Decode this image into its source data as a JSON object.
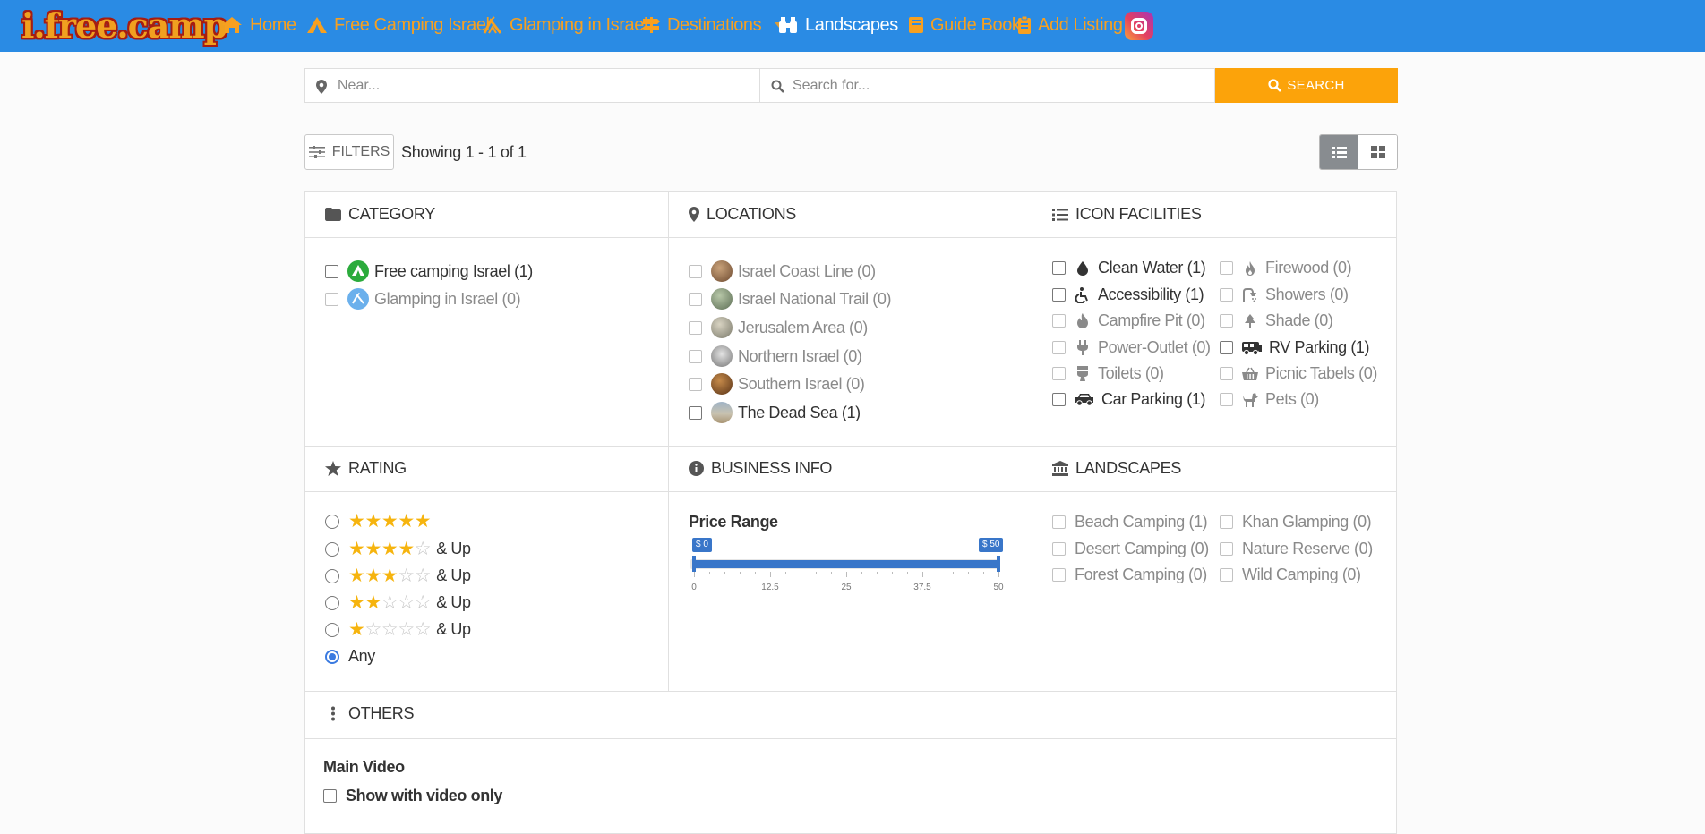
{
  "brand": {
    "logo_text": "i.free.camp"
  },
  "nav": {
    "items": [
      {
        "label": "Home",
        "icon": "home-icon"
      },
      {
        "label": "Free Camping Israel",
        "icon": "camping-tent-icon"
      },
      {
        "label": "Glamping in Israel",
        "icon": "glamping-tent-icon"
      },
      {
        "label": "Destinations",
        "icon": "signpost-icon",
        "dropdown": true
      },
      {
        "label": "Landscapes",
        "icon": "binoculars-icon",
        "dropdown": true,
        "active": true
      },
      {
        "label": "Guide Book",
        "icon": "book-icon"
      },
      {
        "label": "Add Listing",
        "icon": "clipboard-icon"
      }
    ],
    "social_icon": "instagram-icon"
  },
  "search": {
    "near_placeholder": "Near...",
    "query_placeholder": "Search for...",
    "button_label": "SEARCH"
  },
  "toolbar": {
    "filters_label": "FILTERS",
    "showing_text": "Showing 1 - 1 of 1",
    "view_modes": [
      "list",
      "grid"
    ],
    "active_view": "list"
  },
  "filters": {
    "category": {
      "title": "CATEGORY",
      "options": [
        {
          "label": "Free camping Israel (1)",
          "enabled": true
        },
        {
          "label": "Glamping in Israel (0)",
          "enabled": false
        }
      ]
    },
    "locations": {
      "title": "LOCATIONS",
      "options": [
        {
          "label": "Israel Coast Line (0)",
          "enabled": false
        },
        {
          "label": "Israel National Trail (0)",
          "enabled": false
        },
        {
          "label": "Jerusalem Area (0)",
          "enabled": false
        },
        {
          "label": "Northern Israel (0)",
          "enabled": false
        },
        {
          "label": "Southern Israel (0)",
          "enabled": false
        },
        {
          "label": "The Dead Sea (1)",
          "enabled": true
        }
      ]
    },
    "facilities": {
      "title": "ICON FACILITIES",
      "options": [
        {
          "label": "Clean Water (1)",
          "icon": "water-drop-icon",
          "enabled": true
        },
        {
          "label": "Firewood (0)",
          "icon": "fire-icon",
          "enabled": false
        },
        {
          "label": "Accessibility (1)",
          "icon": "wheelchair-icon",
          "enabled": true
        },
        {
          "label": "Showers (0)",
          "icon": "shower-icon",
          "enabled": false
        },
        {
          "label": "Campfire Pit (0)",
          "icon": "flame-icon",
          "enabled": false
        },
        {
          "label": "Shade (0)",
          "icon": "tree-icon",
          "enabled": false
        },
        {
          "label": "Power-Outlet (0)",
          "icon": "plug-icon",
          "enabled": false
        },
        {
          "label": "RV Parking (1)",
          "icon": "rv-icon",
          "enabled": true
        },
        {
          "label": "Toilets (0)",
          "icon": "toilet-icon",
          "enabled": false
        },
        {
          "label": "Picnic Tabels (0)",
          "icon": "picnic-basket-icon",
          "enabled": false
        },
        {
          "label": "Car Parking (1)",
          "icon": "car-icon",
          "enabled": true
        },
        {
          "label": "Pets (0)",
          "icon": "dog-icon",
          "enabled": false
        }
      ]
    },
    "rating": {
      "title": "RATING",
      "options": [
        {
          "stars": 5,
          "suffix": ""
        },
        {
          "stars": 4,
          "suffix": "& Up"
        },
        {
          "stars": 3,
          "suffix": "& Up"
        },
        {
          "stars": 2,
          "suffix": "& Up"
        },
        {
          "stars": 1,
          "suffix": "& Up"
        },
        {
          "stars": 0,
          "suffix": "Any"
        }
      ],
      "selected_index": 5
    },
    "business_info": {
      "title": "BUSINESS INFO",
      "price_range_label": "Price Range",
      "min_label": "$ 0",
      "max_label": "$ 50",
      "min": 0,
      "max": 50,
      "selected_min": 0,
      "selected_max": 50,
      "ticks": [
        "0",
        "12.5",
        "25",
        "37.5",
        "50"
      ]
    },
    "landscapes": {
      "title": "LANDSCAPES",
      "options": [
        {
          "label": "Beach Camping (1)",
          "enabled": false
        },
        {
          "label": "Khan Glamping (0)",
          "enabled": false
        },
        {
          "label": "Desert Camping (0)",
          "enabled": false
        },
        {
          "label": "Nature Reserve (0)",
          "enabled": false
        },
        {
          "label": "Forest Camping (0)",
          "enabled": false
        },
        {
          "label": "Wild Camping (0)",
          "enabled": false
        }
      ]
    },
    "others": {
      "title": "OTHERS",
      "sub_title": "Main Video",
      "video_label": "Show with video only"
    }
  },
  "colors": {
    "navbar": "#2a8be4",
    "nav_link": "#f7a020",
    "search_button": "#fca30a",
    "star": "#f6b40e",
    "slider": "#3976c9"
  }
}
